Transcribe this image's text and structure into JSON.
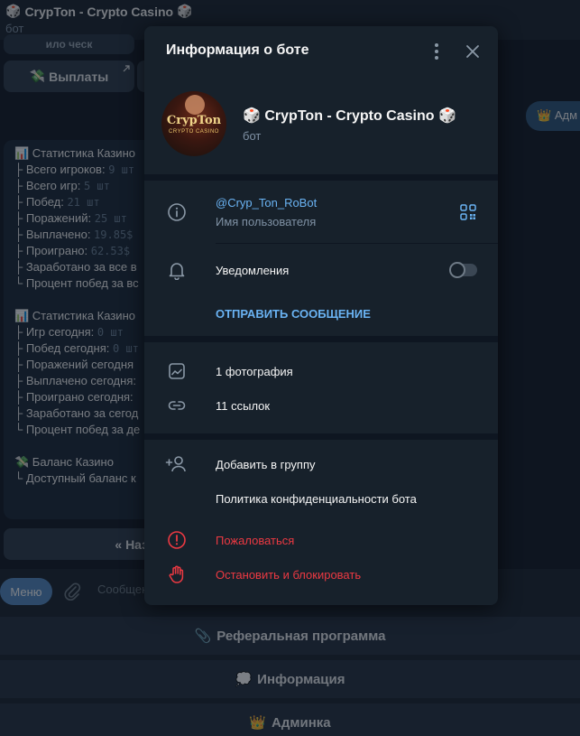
{
  "chat": {
    "title": "CrypTon - Crypto Casino",
    "status": "бот",
    "title_emoji": "🎲",
    "partial_top_text": "ило ческ",
    "payouts_button": "Выплаты",
    "payouts_emoji": "💸",
    "admin_pill": "Адм",
    "admin_emoji": "👑",
    "message_lines": [
      {
        "text": "📊 Статистика Казино",
        "mono": ""
      },
      {
        "text": "├ Всего игроков: ",
        "mono": "9 шт"
      },
      {
        "text": "├ Всего игр: ",
        "mono": "5 шт"
      },
      {
        "text": "├ Побед: ",
        "mono": "21 шт"
      },
      {
        "text": "├ Поражений: ",
        "mono": "25 шт"
      },
      {
        "text": "├ Выплачено: ",
        "mono": "19.85$"
      },
      {
        "text": "├ Проиграно: ",
        "mono": "62.53$"
      },
      {
        "text": "├ Заработано за все в",
        "mono": ""
      },
      {
        "text": "└ Процент побед за вс",
        "mono": ""
      },
      {
        "text": "",
        "mono": ""
      },
      {
        "text": "📊 Статистика Казино",
        "mono": ""
      },
      {
        "text": "├ Игр сегодня: ",
        "mono": "0 шт"
      },
      {
        "text": "├ Побед сегодня: ",
        "mono": "0 шт"
      },
      {
        "text": "├ Поражений сегодня",
        "mono": ""
      },
      {
        "text": "├ Выплачено сегодня:",
        "mono": ""
      },
      {
        "text": "├ Проиграно сегодня:",
        "mono": ""
      },
      {
        "text": "├ Заработано за сегод",
        "mono": ""
      },
      {
        "text": "└ Процент побед за де",
        "mono": ""
      },
      {
        "text": "",
        "mono": ""
      },
      {
        "text": "💸 Баланс Казино",
        "mono": ""
      },
      {
        "text": "└ Доступный баланс к",
        "mono": ""
      }
    ],
    "back_button": "« Назад",
    "menu_button": "Меню",
    "input_placeholder": "Сообщен",
    "bottom_buttons": [
      {
        "emoji": "📎",
        "label": "Реферальная программа"
      },
      {
        "emoji": "💭",
        "label": "Информация"
      },
      {
        "emoji": "👑",
        "label": "Админка"
      }
    ]
  },
  "dialog": {
    "title": "Информация о боте",
    "bot_name": "CrypTon - Crypto Casino",
    "bot_emoji": "🎲",
    "bot_status": "бот",
    "avatar_text": "CrypTon",
    "avatar_subtext": "CRYPTO CASINO",
    "username": "@Cryp_Ton_RoBot",
    "username_caption": "Имя пользователя",
    "notifications": "Уведомления",
    "notifications_enabled": false,
    "send_message": "ОТПРАВИТЬ СООБЩЕНИЕ",
    "photos": "1 фотография",
    "links": "11 ссылок",
    "add_to_group": "Добавить в группу",
    "privacy_policy": "Политика конфиденциальности бота",
    "report": "Пожаловаться",
    "stop_block": "Остановить и блокировать",
    "colors": {
      "link": "#6ab3f3",
      "danger": "#ec3942",
      "panel": "#17212b"
    }
  }
}
